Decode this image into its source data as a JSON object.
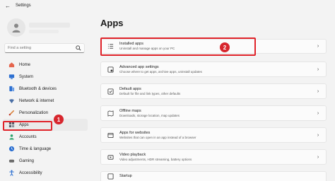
{
  "window": {
    "title": "Settings",
    "back_icon": "back-arrow-icon"
  },
  "sidebar": {
    "search_placeholder": "Find a setting",
    "items": [
      {
        "label": "Home",
        "icon": "home-icon",
        "color": "#e5654d"
      },
      {
        "label": "System",
        "icon": "monitor-icon",
        "color": "#2b6fd1"
      },
      {
        "label": "Bluetooth & devices",
        "icon": "bluetooth-icon",
        "color": "#2b6fd1"
      },
      {
        "label": "Network & internet",
        "icon": "wifi-icon",
        "color": "#4a6fa5"
      },
      {
        "label": "Personalization",
        "icon": "brush-icon",
        "color": "#d9823b"
      },
      {
        "label": "Apps",
        "icon": "apps-icon",
        "color": "#5a5f6b"
      },
      {
        "label": "Accounts",
        "icon": "person-icon",
        "color": "#2aa36b"
      },
      {
        "label": "Time & language",
        "icon": "globe-clock-icon",
        "color": "#2b6fd1"
      },
      {
        "label": "Gaming",
        "icon": "gamepad-icon",
        "color": "#6b6b6b"
      },
      {
        "label": "Accessibility",
        "icon": "accessibility-icon",
        "color": "#2b6fd1"
      }
    ],
    "active": "Apps"
  },
  "main": {
    "title": "Apps",
    "cards": [
      {
        "title": "Installed apps",
        "subtitle": "Uninstall and manage apps on your PC",
        "icon": "list-icon"
      },
      {
        "title": "Advanced app settings",
        "subtitle": "Choose where to get apps, archive apps, uninstall updates",
        "icon": "app-settings-icon"
      },
      {
        "title": "Default apps",
        "subtitle": "Default for file and link types, other defaults",
        "icon": "default-apps-icon"
      },
      {
        "title": "Offline maps",
        "subtitle": "Downloads, storage location, map updates",
        "icon": "map-icon"
      },
      {
        "title": "Apps for websites",
        "subtitle": "Websites that can open in an app instead of a browser",
        "icon": "web-app-icon"
      },
      {
        "title": "Video playback",
        "subtitle": "Video adjustments, HDR streaming, battery options",
        "icon": "video-icon"
      },
      {
        "title": "Startup",
        "subtitle": "",
        "icon": "startup-icon"
      }
    ]
  },
  "annotations": {
    "badge_1": "1",
    "badge_2": "2",
    "color": "#e0232a"
  },
  "colors": {
    "accent": "#005fb8",
    "background": "#f3f3f3",
    "card": "#fbfbfb"
  }
}
